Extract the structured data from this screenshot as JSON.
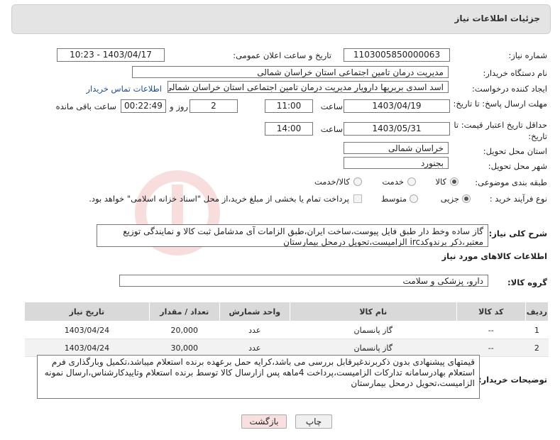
{
  "header": {
    "title": "جزئیات اطلاعات نیاز"
  },
  "fields": {
    "need_number_label": "شماره نیاز:",
    "need_number": "1103005850000063",
    "announce_label": "تاریخ و ساعت اعلان عمومی:",
    "announce_value": "1403/04/17 - 10:23",
    "buyer_org_label": "نام دستگاه خریدار:",
    "buyer_org": "مدیریت درمان تامین اجتماعی استان خراسان شمالی",
    "creator_label": "ایجاد کننده درخواست:",
    "creator": "اسد اسدی بربریها دارویار مدیریت درمان تامین اجتماعی استان خراسان شمالی",
    "contact_link": "اطلاعات تماس خریدار",
    "deadline_label": "مهلت ارسال پاسخ: تا تاریخ:",
    "deadline_date": "1403/04/19",
    "time_label": "ساعت",
    "deadline_time": "11:00",
    "days_value": "2",
    "days_label": "روز و",
    "remaining_value": "00:22:49",
    "remaining_label": "ساعت باقی مانده",
    "validity_label": "حداقل تاریخ اعتبار قیمت: تا تاریخ:",
    "validity_date": "1403/05/31",
    "validity_time": "14:00",
    "province_label": "استان محل تحویل:",
    "province": "خراسان شمالی",
    "city_label": "شهر محل تحویل:",
    "city": "بجنورد",
    "category_label": "طبقه بندی موضوعی:",
    "category_options": [
      "کالا",
      "خدمت",
      "کالا/خدمت"
    ],
    "process_label": "نوع فرآیند خرید :",
    "process_options": [
      "جزیی",
      "متوسط"
    ],
    "payment_note": "پرداخت تمام یا بخشی از مبلغ خرید،از محل \"اسناد خزانه اسلامی\" خواهد بود.",
    "summary_label": "شرح کلی نیاز:",
    "summary": "گاز ساده وخط دار طبق فایل پیوست،ساخت ایران،طبق الزامات آی مدشامل ثبت کالا و نمایندگی توزیع معتبر،ذکر برندوکدirc الزامیست،تحویل درمحل بیمارستان",
    "goods_info_title": "اطلاعات کالاهای مورد نیاز",
    "goods_group_label": "گروه کالا:",
    "goods_group": "دارو، پزشکی و سلامت"
  },
  "table": {
    "headers": [
      "ردیف",
      "کد کالا",
      "نام کالا",
      "واحد شمارش",
      "تعداد / مقدار",
      "تاریخ نیاز"
    ],
    "rows": [
      [
        "1",
        "--",
        "گاز پانسمان",
        "عدد",
        "20,000",
        "1403/04/24"
      ],
      [
        "2",
        "--",
        "گاز پانسمان",
        "عدد",
        "30,000",
        "1403/04/24"
      ]
    ]
  },
  "buyer_notes_label": "توضیحات خریدار:",
  "buyer_notes": "قیمتهای پیشنهادی بدون ذکربرندغیرقابل بررسی می باشد،کرایه حمل برعهده برنده استعلام میباشد،تکمیل وبارگذاری فرم استعلام بهادرسامانه تدارکات الزامیست،پرداخت 4ماهه پس ازارسال کالا توسط برنده استعلام وتاییدکارشناس،ارسال نمونه الزامیست،تحویل درمحل بیمارستان",
  "buttons": {
    "print": "چاپ",
    "back": "بازگشت"
  },
  "colors": {
    "panel": "#e4e4e4",
    "link": "#1a4d99",
    "table_header": "#d9d9d9",
    "back_button": "#f8e0e0"
  }
}
